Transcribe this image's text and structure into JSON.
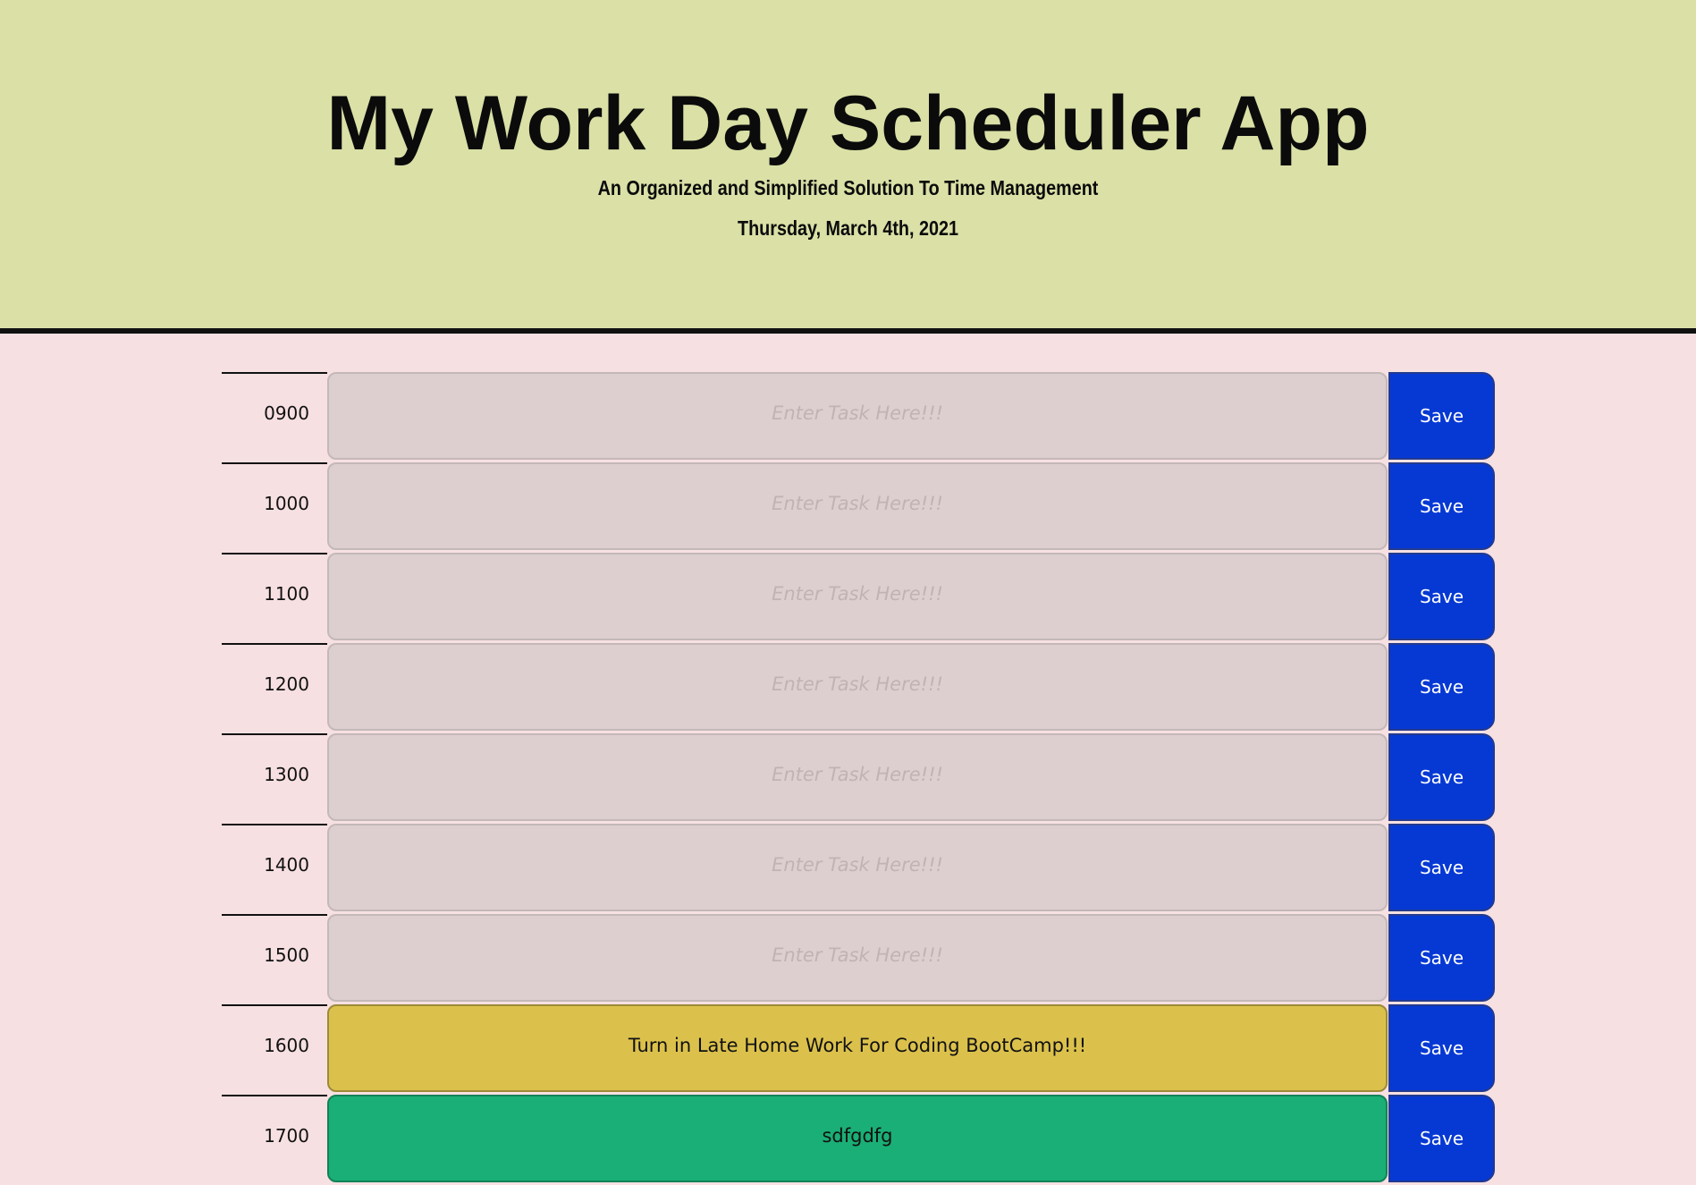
{
  "header": {
    "title": "My Work Day Scheduler App",
    "subtitle": "An Organized and Simplified Solution To Time Management",
    "current_day": "Thursday, March 4th, 2021"
  },
  "placeholder": "Enter Task Here!!!",
  "save_label": "Save",
  "colors": {
    "past": "#ddcfcf",
    "present": "#dbc14c",
    "future": "#1aaf76",
    "save_button": "#0639d4",
    "header_bg": "#dae0a6",
    "page_bg": "#f7e0e2"
  },
  "time_blocks": [
    {
      "hour": "0900",
      "task": "",
      "status": "past"
    },
    {
      "hour": "1000",
      "task": "",
      "status": "past"
    },
    {
      "hour": "1100",
      "task": "",
      "status": "past"
    },
    {
      "hour": "1200",
      "task": "",
      "status": "past"
    },
    {
      "hour": "1300",
      "task": "",
      "status": "past"
    },
    {
      "hour": "1400",
      "task": "",
      "status": "past"
    },
    {
      "hour": "1500",
      "task": "",
      "status": "past"
    },
    {
      "hour": "1600",
      "task": "Turn in Late Home Work For Coding BootCamp!!!",
      "status": "present"
    },
    {
      "hour": "1700",
      "task": "sdfgdfg",
      "status": "future"
    }
  ]
}
